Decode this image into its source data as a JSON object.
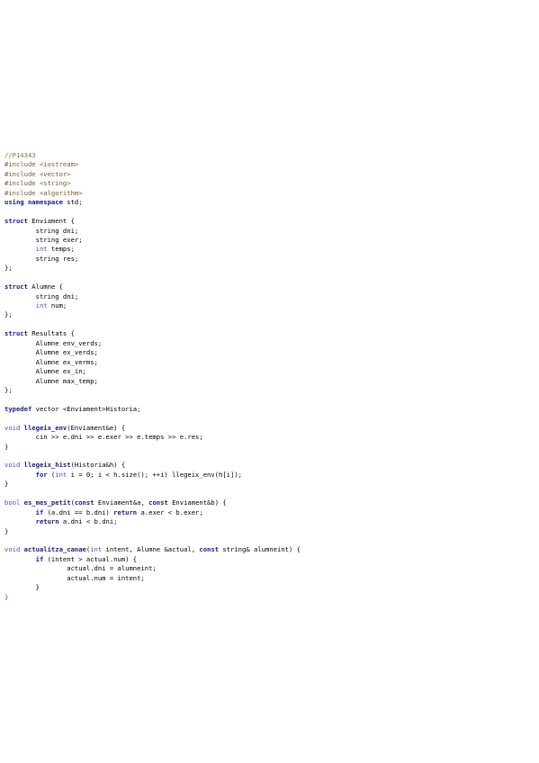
{
  "source_code": {
    "lines": [
      [
        {
          "t": "//P14343",
          "c": "cm"
        }
      ],
      [
        {
          "t": "#include <iostream>",
          "c": "pp"
        }
      ],
      [
        {
          "t": "#include <vector>",
          "c": "pp"
        }
      ],
      [
        {
          "t": "#include <string>",
          "c": "pp"
        }
      ],
      [
        {
          "t": "#include <algorithm>",
          "c": "pp"
        }
      ],
      [
        {
          "t": "using namespace",
          "c": "kw"
        },
        {
          "t": " std;",
          "c": "tx"
        }
      ],
      [],
      [
        {
          "t": "struct",
          "c": "kw"
        },
        {
          "t": " Enviament {",
          "c": "tx"
        }
      ],
      [
        {
          "t": "        string dni;",
          "c": "tx"
        }
      ],
      [
        {
          "t": "        string exer;",
          "c": "tx"
        }
      ],
      [
        {
          "t": "        int",
          "c": "ty"
        },
        {
          "t": " temps;",
          "c": "tx"
        }
      ],
      [
        {
          "t": "        string res;",
          "c": "tx"
        }
      ],
      [
        {
          "t": "};",
          "c": "tx"
        }
      ],
      [],
      [
        {
          "t": "struct",
          "c": "kw"
        },
        {
          "t": " Alumne {",
          "c": "tx"
        }
      ],
      [
        {
          "t": "        string dni;",
          "c": "tx"
        }
      ],
      [
        {
          "t": "        int",
          "c": "ty"
        },
        {
          "t": " num;",
          "c": "tx"
        }
      ],
      [
        {
          "t": "};",
          "c": "tx"
        }
      ],
      [],
      [
        {
          "t": "struct",
          "c": "kw"
        },
        {
          "t": " Resultats {",
          "c": "tx"
        }
      ],
      [
        {
          "t": "        Alumne env_verds;",
          "c": "tx"
        }
      ],
      [
        {
          "t": "        Alumne ex_verds;",
          "c": "tx"
        }
      ],
      [
        {
          "t": "        Alumne ex_verms;",
          "c": "tx"
        }
      ],
      [
        {
          "t": "        Alumne ex_in;",
          "c": "tx"
        }
      ],
      [
        {
          "t": "        Alumne max_temp;",
          "c": "tx"
        }
      ],
      [
        {
          "t": "};",
          "c": "tx"
        }
      ],
      [],
      [
        {
          "t": "typedef",
          "c": "kw"
        },
        {
          "t": " vector <Enviament>Historia;",
          "c": "tx"
        }
      ],
      [],
      [
        {
          "t": "void",
          "c": "ty"
        },
        {
          "t": " llegeix_env",
          "c": "fn"
        },
        {
          "t": "(Enviament&e) {",
          "c": "tx"
        }
      ],
      [
        {
          "t": "        cin >> e.dni >> e.exer >> e.temps >> e.res;",
          "c": "tx"
        }
      ],
      [
        {
          "t": "}",
          "c": "tx"
        }
      ],
      [],
      [
        {
          "t": "void",
          "c": "ty"
        },
        {
          "t": " llegeix_hist",
          "c": "fn"
        },
        {
          "t": "(Historia&h) {",
          "c": "tx"
        }
      ],
      [
        {
          "t": "        for",
          "c": "kw"
        },
        {
          "t": " (",
          "c": "tx"
        },
        {
          "t": "int",
          "c": "ty"
        },
        {
          "t": " i = 0; i < h.size(); ++i) llegeix_env(h[i]);",
          "c": "tx"
        }
      ],
      [
        {
          "t": "}",
          "c": "tx"
        }
      ],
      [],
      [
        {
          "t": "bool",
          "c": "ty"
        },
        {
          "t": " es_mes_petit",
          "c": "fn"
        },
        {
          "t": "(",
          "c": "tx"
        },
        {
          "t": "const",
          "c": "kw"
        },
        {
          "t": " Enviament&a, ",
          "c": "tx"
        },
        {
          "t": "const",
          "c": "kw"
        },
        {
          "t": " Enviament&b) {",
          "c": "tx"
        }
      ],
      [
        {
          "t": "        if",
          "c": "kw"
        },
        {
          "t": " (a.dni == b.dni) ",
          "c": "tx"
        },
        {
          "t": "return",
          "c": "kw"
        },
        {
          "t": " a.exer < b.exer;",
          "c": "tx"
        }
      ],
      [
        {
          "t": "        return",
          "c": "kw"
        },
        {
          "t": " a.dni < b.dni;",
          "c": "tx"
        }
      ],
      [
        {
          "t": "}",
          "c": "tx"
        }
      ],
      [],
      [
        {
          "t": "void",
          "c": "ty"
        },
        {
          "t": " actualitza_canae",
          "c": "fn"
        },
        {
          "t": "(",
          "c": "tx"
        },
        {
          "t": "int",
          "c": "ty"
        },
        {
          "t": " intent, Alumne &actual, ",
          "c": "tx"
        },
        {
          "t": "const",
          "c": "kw"
        },
        {
          "t": " string& alumneint) {",
          "c": "tx"
        }
      ],
      [
        {
          "t": "        if",
          "c": "kw"
        },
        {
          "t": " (intent > actual.num) {",
          "c": "tx"
        }
      ],
      [
        {
          "t": "                actual.dni = alumneint;",
          "c": "tx"
        }
      ],
      [
        {
          "t": "                actual.num = intent;",
          "c": "tx"
        }
      ],
      [
        {
          "t": "        }",
          "c": "tx"
        }
      ],
      [
        {
          "t": "}",
          "c": "rd"
        }
      ]
    ]
  },
  "colors": {
    "keyword": "#1a1a8c",
    "preprocessor": "#7a5b2e",
    "comment": "#5d8a3a",
    "type": "#6a3fb5",
    "text": "#000000"
  }
}
